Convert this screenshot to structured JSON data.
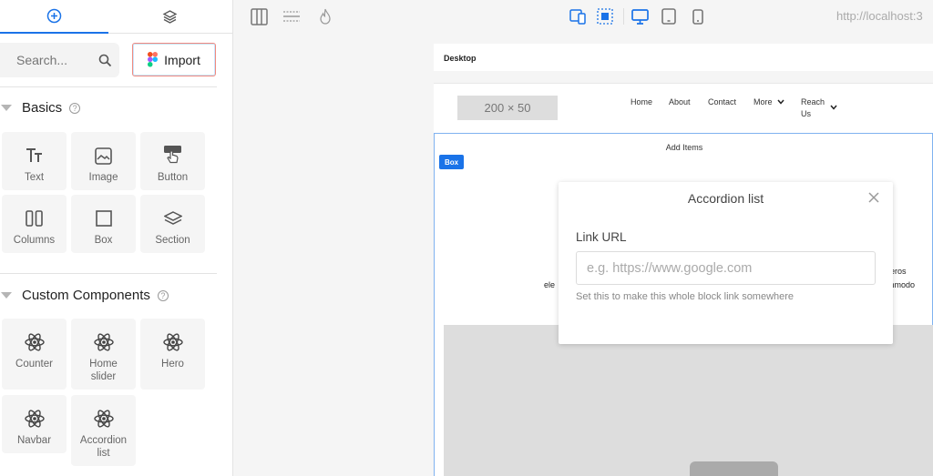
{
  "sidebar": {
    "search_placeholder": "Search...",
    "import_label": "Import",
    "basics": {
      "title": "Basics",
      "help": "?",
      "items": [
        {
          "label": "Text",
          "icon": "text-icon"
        },
        {
          "label": "Image",
          "icon": "image-icon"
        },
        {
          "label": "Button",
          "icon": "button-icon"
        },
        {
          "label": "Columns",
          "icon": "columns-icon"
        },
        {
          "label": "Box",
          "icon": "box-icon"
        },
        {
          "label": "Section",
          "icon": "section-icon"
        }
      ]
    },
    "custom": {
      "title": "Custom Components",
      "help": "?",
      "items": [
        {
          "label": "Counter",
          "icon": "react-icon"
        },
        {
          "label": "Home slider",
          "icon": "react-icon"
        },
        {
          "label": "Hero",
          "icon": "react-icon"
        },
        {
          "label": "Navbar",
          "icon": "react-icon"
        },
        {
          "label": "Accordion list",
          "icon": "react-icon"
        }
      ]
    }
  },
  "toolbar": {
    "url": "http://localhost:3",
    "accent": "#1a73e8"
  },
  "canvas": {
    "device_label": "Desktop",
    "logo_placeholder": "200 × 50",
    "nav": {
      "home": "Home",
      "about": "About",
      "contact": "Contact",
      "more": "More",
      "reach_us": "Reach Us"
    },
    "box_tag": "Box",
    "add_items": "Add Items",
    "text_fragments": [
      "eros",
      "ele",
      "mmodo"
    ]
  },
  "modal": {
    "title": "Accordion list",
    "field_label": "Link URL",
    "placeholder": "e.g. https://www.google.com",
    "help": "Set this to make this whole block link somewhere"
  }
}
